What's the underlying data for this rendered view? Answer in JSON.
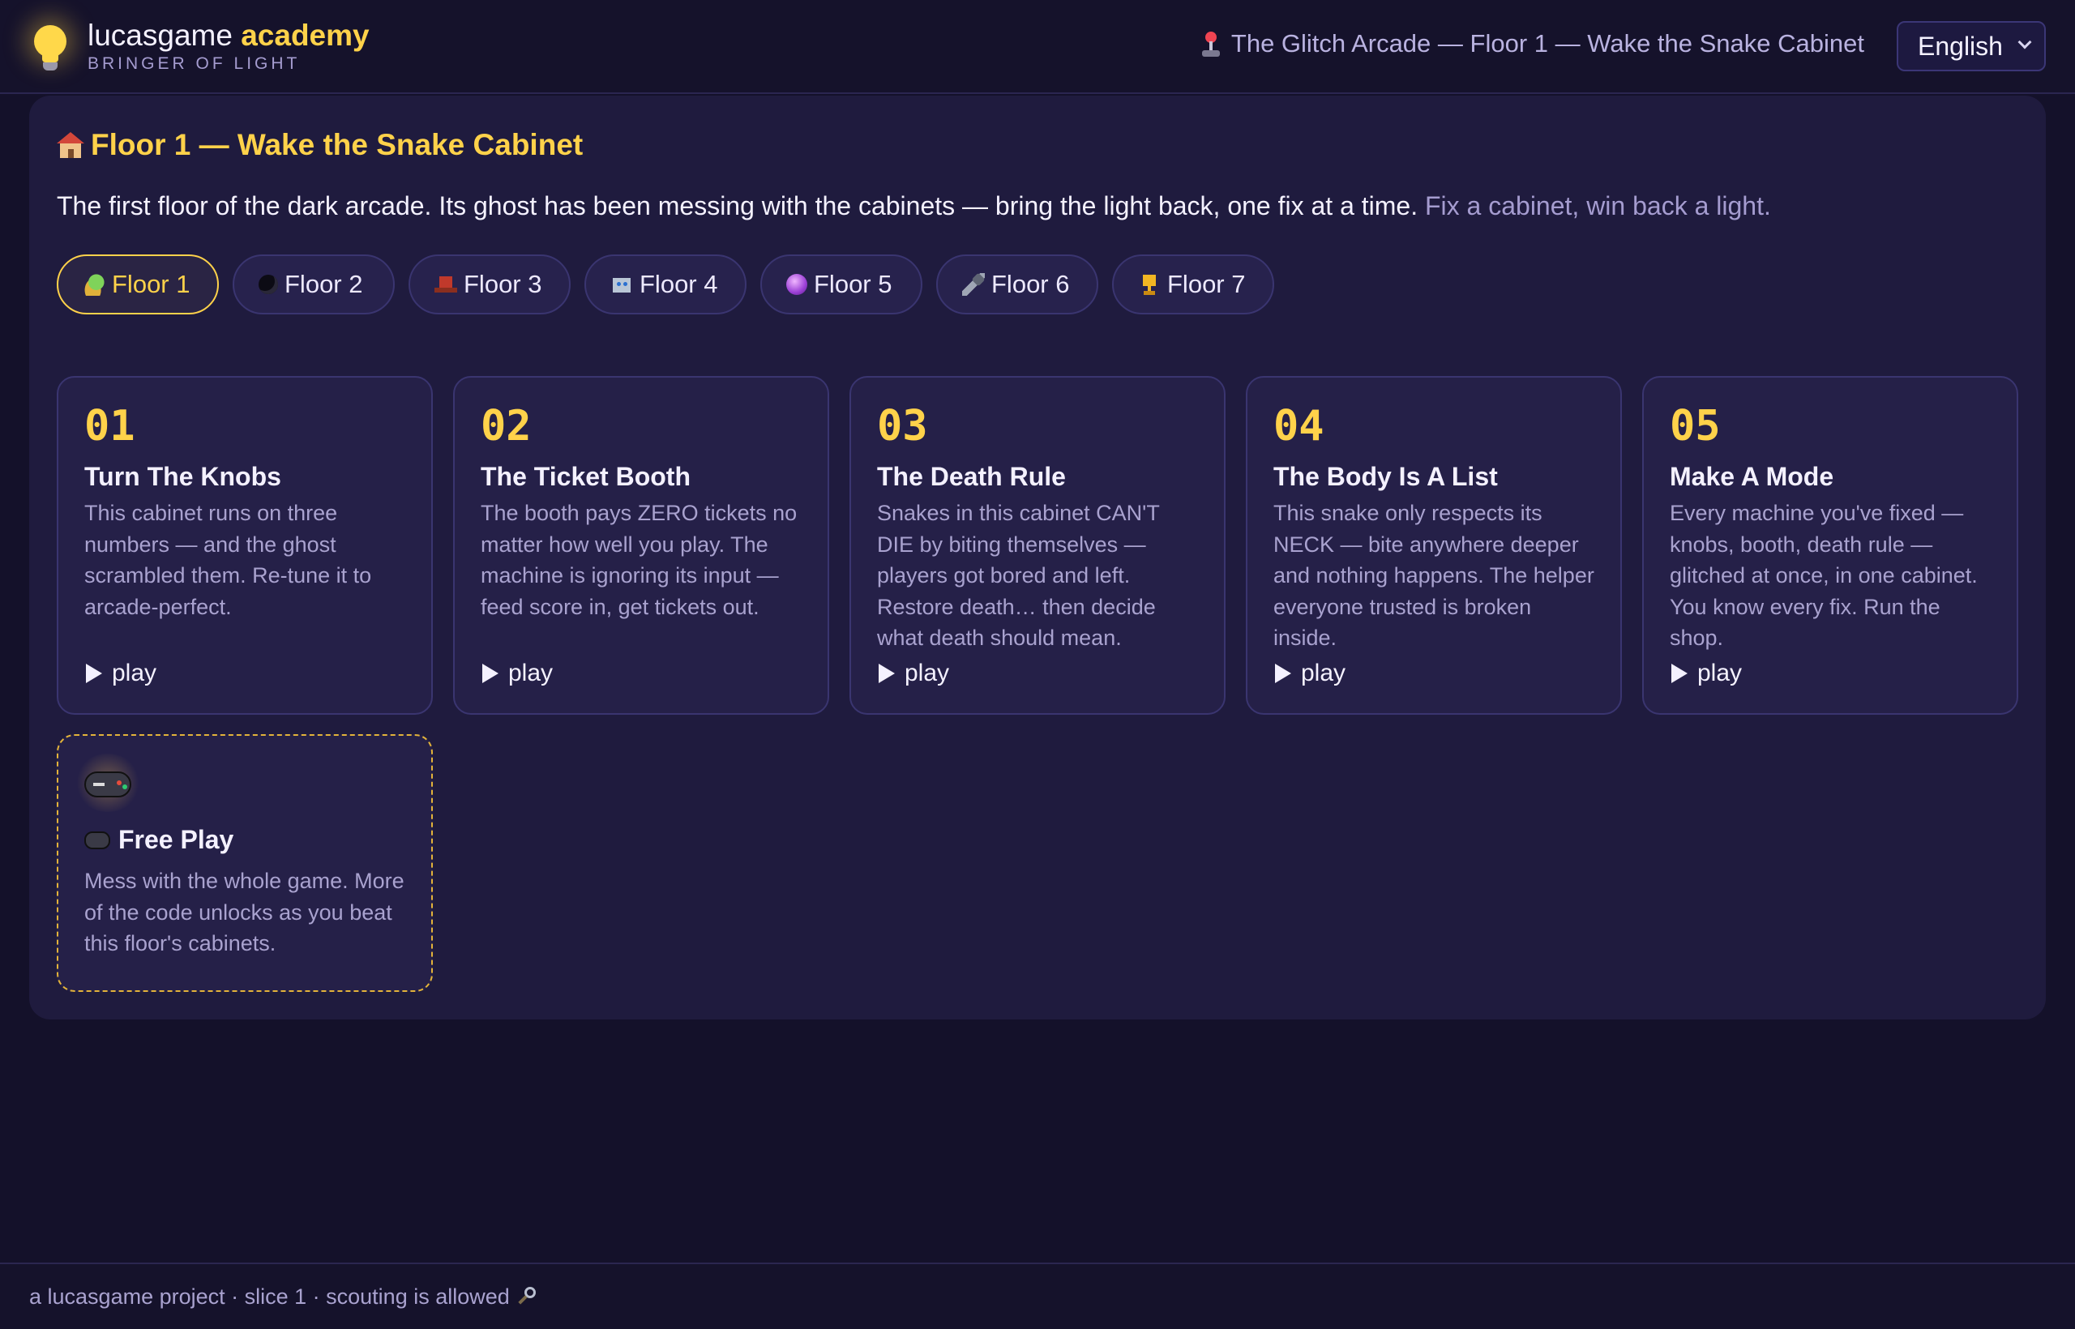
{
  "header": {
    "brand_name": "lucasgame",
    "brand_accent": "academy",
    "brand_sub": "BRINGER OF LIGHT",
    "breadcrumb": "The Glitch Arcade — Floor 1 — Wake the Snake Cabinet",
    "language": "English"
  },
  "floor": {
    "title": "Floor 1 — Wake the Snake Cabinet",
    "intro": "The first floor of the dark arcade. Its ghost has been messing with the cabinets — bring the light back, one fix at a time.",
    "intro_hint": "Fix a cabinet, win back a light."
  },
  "tabs": [
    {
      "label": "Floor 1",
      "icon": "snake-icon",
      "active": true
    },
    {
      "label": "Floor 2",
      "icon": "bomb-icon"
    },
    {
      "label": "Floor 3",
      "icon": "hat-icon"
    },
    {
      "label": "Floor 4",
      "icon": "robot-icon"
    },
    {
      "label": "Floor 5",
      "icon": "crystal-ball-icon"
    },
    {
      "label": "Floor 6",
      "icon": "plug-icon"
    },
    {
      "label": "Floor 7",
      "icon": "trophy-icon"
    }
  ],
  "cabinets": [
    {
      "num": "01",
      "title": "Turn The Knobs",
      "desc": "This cabinet runs on three numbers — and the ghost scrambled them. Re-tune it to arcade-perfect.",
      "action": "play"
    },
    {
      "num": "02",
      "title": "The Ticket Booth",
      "desc": "The booth pays ZERO tickets no matter how well you play. The machine is ignoring its input — feed score in, get tickets out.",
      "action": "play"
    },
    {
      "num": "03",
      "title": "The Death Rule",
      "desc": "Snakes in this cabinet CAN'T DIE by biting themselves — players got bored and left. Restore death… then decide what death should mean.",
      "action": "play"
    },
    {
      "num": "04",
      "title": "The Body Is A List",
      "desc": "This snake only respects its NECK — bite anywhere deeper and nothing happens. The helper everyone trusted is broken inside.",
      "action": "play"
    },
    {
      "num": "05",
      "title": "Make A Mode",
      "desc": "Every machine you've fixed — knobs, booth, death rule — glitched at once, in one cabinet. You know every fix. Run the shop.",
      "action": "play"
    }
  ],
  "free_play": {
    "title": "Free Play",
    "desc": "Mess with the whole game. More of the code unlocks as you beat this floor's cabinets."
  },
  "footer": {
    "text": "a lucasgame project · slice 1 · scouting is allowed"
  },
  "colors": {
    "background": "#14112a",
    "panel": "#1f1b3e",
    "accent": "#ffd24a",
    "muted_text": "#a9a2cf"
  }
}
